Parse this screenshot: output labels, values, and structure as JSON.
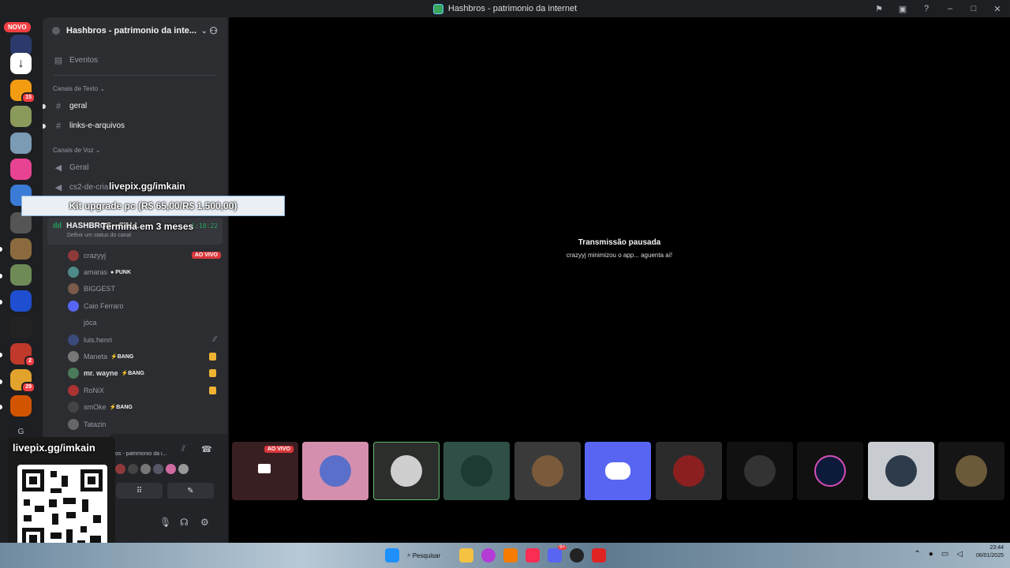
{
  "window": {
    "title": "Hashbros - patrimonio da internet"
  },
  "rail": {
    "novo_label": "NOVO",
    "badges": [
      "15",
      "2",
      "29"
    ],
    "letter": "G"
  },
  "server": {
    "name": "Hashbros - patrimonio da inte..."
  },
  "sidebar": {
    "events": "Eventos",
    "text_category": "Canais de Texto",
    "text_channels": [
      "geral",
      "links-e-arquivos"
    ],
    "voice_category": "Canais de Voz",
    "voice_channels": [
      "Geral",
      "cs2-de-cria"
    ],
    "active_voice": {
      "name": "HASHBROS - CALL",
      "status": "Definir um status do canal",
      "timer": "1:18:22"
    }
  },
  "members": [
    {
      "name": "crazyyj",
      "badge": "AO VIVO"
    },
    {
      "name": "amaras",
      "tag": "PUNK"
    },
    {
      "name": "BIGGEST"
    },
    {
      "name": "Caio Ferraro"
    },
    {
      "name": "jóca"
    },
    {
      "name": "luis.henri"
    },
    {
      "name": "Maneta",
      "tag": "BANG"
    },
    {
      "name": "mr. wayne",
      "tag": "BANG"
    },
    {
      "name": "RoNiX"
    },
    {
      "name": "smOke",
      "tag": "BANG"
    },
    {
      "name": "Tatazin"
    }
  ],
  "voice_panel": {
    "title": "os - patrimonio da i..."
  },
  "overlay": {
    "link_top": "livepix.gg/imkain",
    "goal": "Kit upgrade pc (R$ 65,00/R$ 1.500,00)",
    "ends": "Termina em 3 meses",
    "link_bottom": "livepix.gg/imkain"
  },
  "stream": {
    "paused_title": "Transmissão pausada",
    "paused_sub": "crazyyj minimizou o app... aguenta aí!"
  },
  "tiles": {
    "live_label": "AO VIVO"
  },
  "taskbar": {
    "search": "Pesquisar",
    "time": "23:44",
    "date": "06/01/2025",
    "badge": "9+"
  },
  "colors": {
    "accent": "#5865f2",
    "live": "#da373c",
    "online": "#23a55a"
  }
}
